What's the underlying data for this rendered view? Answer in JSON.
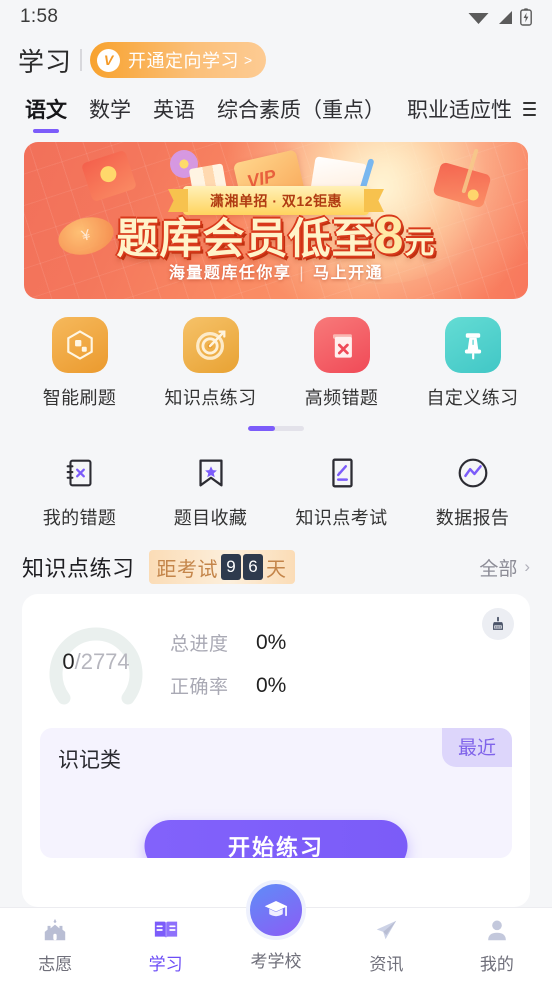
{
  "status_bar": {
    "time": "1:58",
    "icons": [
      "wifi-icon",
      "signal-icon",
      "battery-charging-icon"
    ]
  },
  "header": {
    "title": "学习",
    "vip_badge": {
      "mark": "V",
      "label": "开通定向学习",
      "arrow": ">"
    }
  },
  "subject_tabs": {
    "items": [
      {
        "label": "语文",
        "active": true
      },
      {
        "label": "数学",
        "active": false
      },
      {
        "label": "英语",
        "active": false
      },
      {
        "label": "综合素质（重点）",
        "active": false
      },
      {
        "label": "职业适应性",
        "active": false
      }
    ],
    "menu_icon": "hamburger-icon"
  },
  "banner": {
    "ribbon": "潇湘单招 · 双12钜惠",
    "headline_1": "题库会员低至",
    "headline_num": "8",
    "headline_unit": "元",
    "sub_left": "海量题库任你享",
    "sub_divider": "|",
    "sub_right": "马上开通",
    "card_mark": "VIP"
  },
  "quick_entries_row1": [
    {
      "label": "智能刷题",
      "icon": "cube-icon",
      "color": "#eb9a2e"
    },
    {
      "label": "知识点练习",
      "icon": "target-icon",
      "color": "#e8a233"
    },
    {
      "label": "高频错题",
      "icon": "book-x-icon",
      "color": "#f04a57"
    },
    {
      "label": "自定义练习",
      "icon": "pushpin-icon",
      "color": "#41c7c6"
    }
  ],
  "pager": {
    "active_index": 0,
    "total": 2
  },
  "quick_entries_row2": [
    {
      "label": "我的错题",
      "icon": "notebook-x-icon"
    },
    {
      "label": "题目收藏",
      "icon": "bookmark-star-icon"
    },
    {
      "label": "知识点考试",
      "icon": "paper-pen-icon"
    },
    {
      "label": "数据报告",
      "icon": "chart-circle-icon"
    }
  ],
  "section": {
    "title": "知识点练习",
    "countdown": {
      "prefix": "距考试",
      "digits": [
        "9",
        "6"
      ],
      "suffix": "天"
    },
    "more_label": "全部",
    "more_chevron": "›"
  },
  "progress_card": {
    "clear_icon": "broom-icon",
    "ring": {
      "done": "0",
      "separator": "/",
      "total": "2774"
    },
    "stats": [
      {
        "label": "总进度",
        "value": "0%"
      },
      {
        "label": "正确率",
        "value": "0%"
      }
    ],
    "inner": {
      "badge": "最近",
      "title": "识记类",
      "button": "开始练习"
    }
  },
  "bottom_nav": {
    "items": [
      {
        "label": "志愿",
        "icon": "castle-icon",
        "active": false
      },
      {
        "label": "学习",
        "icon": "book-open-icon",
        "active": true
      },
      {
        "label": "资讯",
        "icon": "paper-plane-icon",
        "active": false
      },
      {
        "label": "我的",
        "icon": "person-icon",
        "active": false
      }
    ],
    "center": {
      "label": "考学校",
      "icon": "graduation-cap-icon"
    }
  },
  "colors": {
    "accent_purple": "#7c5cfa",
    "accent_orange": "#f8a22e",
    "banner_red": "#f4775c",
    "countdown_digit_bg": "#2e3a4d"
  }
}
